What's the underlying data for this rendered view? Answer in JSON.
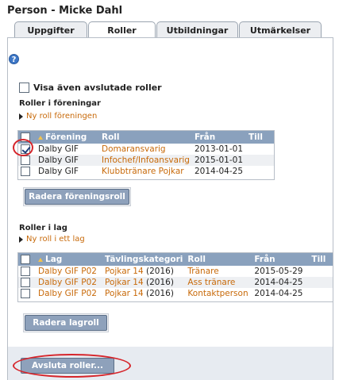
{
  "page": {
    "title": "Person - Micke Dahl"
  },
  "tabs": [
    {
      "label": "Uppgifter",
      "active": false
    },
    {
      "label": "Roller",
      "active": true
    },
    {
      "label": "Utbildningar",
      "active": false
    },
    {
      "label": "Utmärkelser",
      "active": false
    }
  ],
  "help": {
    "icon": "help-icon",
    "glyph": "?"
  },
  "show_ended": {
    "label": "Visa även avslutade roller",
    "checked": false
  },
  "club_roles": {
    "title": "Roller i föreningar",
    "add_link": "Ny roll föreningen",
    "columns": [
      "Förening",
      "Roll",
      "Från",
      "Till"
    ],
    "rows": [
      {
        "checked": true,
        "forening": "Dalby GIF",
        "roll": "Domaransvarig",
        "fran": "2013-01-01",
        "till": ""
      },
      {
        "checked": false,
        "forening": "Dalby GIF",
        "roll": "Infochef/Infoansvarig",
        "fran": "2015-01-01",
        "till": ""
      },
      {
        "checked": false,
        "forening": "Dalby GIF",
        "roll": "Klubbtränare Pojkar",
        "fran": "2014-04-25",
        "till": ""
      }
    ],
    "delete_button": "Radera föreningsroll"
  },
  "team_roles": {
    "title": "Roller i lag",
    "add_link": "Ny roll i ett lag",
    "columns": [
      "Lag",
      "Tävlingskategori",
      "Roll",
      "Från",
      "Till"
    ],
    "rows": [
      {
        "checked": false,
        "lag": "Dalby GIF P02",
        "kategori_link": "Pojkar 14",
        "kategori_year": "(2016)",
        "roll": "Tränare",
        "fran": "2015-05-29",
        "till": ""
      },
      {
        "checked": false,
        "lag": "Dalby GIF P02",
        "kategori_link": "Pojkar 14",
        "kategori_year": "(2016)",
        "roll": "Ass tränare",
        "fran": "2014-04-25",
        "till": ""
      },
      {
        "checked": false,
        "lag": "Dalby GIF P02",
        "kategori_link": "Pojkar 14",
        "kategori_year": "(2016)",
        "roll": "Kontaktperson",
        "fran": "2014-04-25",
        "till": ""
      }
    ],
    "delete_button": "Radera lagroll"
  },
  "end_roles_button": "Avsluta roller...",
  "colors": {
    "header_blue": "#8aa1bd",
    "link_orange": "#c86a0a",
    "highlight_red": "#d6252b",
    "button_blue": "#8ea1bb"
  }
}
